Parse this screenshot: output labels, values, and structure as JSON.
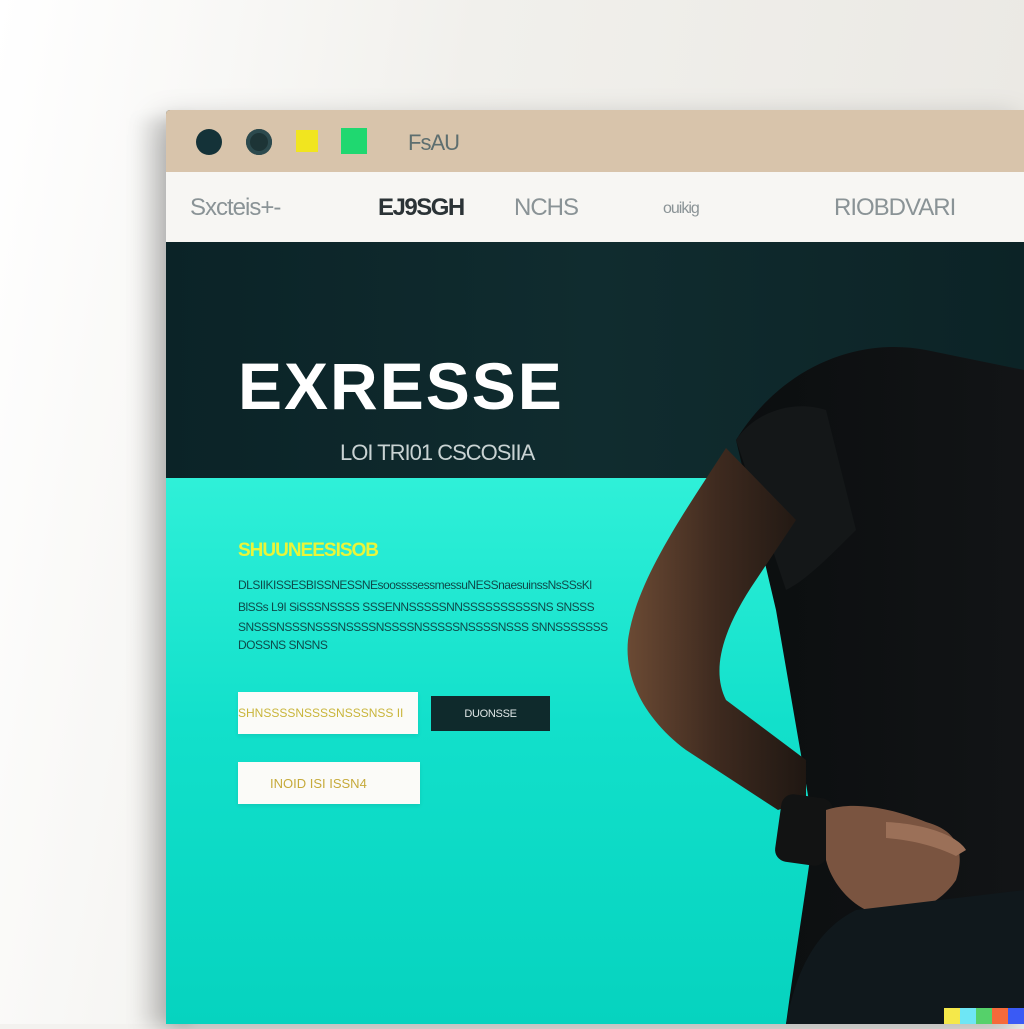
{
  "window": {
    "title": "FsAU",
    "controls": [
      {
        "name": "close",
        "color": "#143238"
      },
      {
        "name": "minimize",
        "color": "#1d3436"
      },
      {
        "name": "yellow-square",
        "color": "#f1e51f"
      },
      {
        "name": "green-square",
        "color": "#1fd870"
      }
    ]
  },
  "nav": {
    "items": [
      "Sxcteis+-",
      "EJ9SGH",
      "NCHS",
      "ouikig",
      "RIOBDVARI"
    ]
  },
  "hero": {
    "title": "EXRESSE",
    "subtitle": "LOI TRI01 CSCOSIIA"
  },
  "promo": {
    "heading": "SHUUNEESISOB",
    "lines": [
      "DLSIIKISSESBISSNESSNEsoossssessmessuNESSnaesuinssNsSSsKl",
      "BlSSs L9I SiSSSNSSSS SSSENNSSSSSNNSSSSSSSSSSNS SNSSS",
      "SNSSSNSSSNSSSNSSSSNSSSSNSSSSSNSSSSNSSS SNNSSSSSSS",
      "DOSSNS SNSNS"
    ]
  },
  "form": {
    "field1_value": "SHNSSSSNSSSSNSSSNSS IIG",
    "cta_label": "DUONSSE",
    "field2_value": "INOID ISI ISSN4"
  },
  "colors": {
    "titlebar": "#d8c4ab",
    "navbar": "#f7f6f3",
    "hero_dark": "#0f2a2c",
    "hero_teal": "#12e0cb",
    "accent_yellow": "#e9f53a",
    "cta": "#0f2a2c"
  }
}
